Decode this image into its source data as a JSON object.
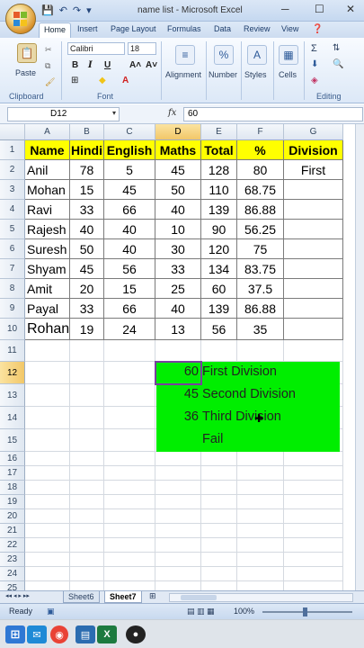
{
  "window": {
    "title": "name list - Microsoft Excel",
    "minimize": "─",
    "maximize": "☐",
    "close": "✕"
  },
  "qat": [
    "💾",
    "↶",
    "↷",
    "▾"
  ],
  "ribbon_tabs": [
    "Home",
    "Insert",
    "Page Layout",
    "Formulas",
    "Data",
    "Review",
    "View"
  ],
  "ribbon": {
    "paste": "Paste",
    "clipboard": "Clipboard",
    "font_name": "Calibri",
    "font_size": "18",
    "bold": "B",
    "italic": "I",
    "underline": "U",
    "grow_font": "A˄",
    "shrink_font": "A˅",
    "font_group": "Font",
    "alignment": "Alignment",
    "number": "Number",
    "styles": "Styles",
    "cells": "Cells",
    "editing": "Editing",
    "percent": "%",
    "sigma": "Σ"
  },
  "formula_bar": {
    "name_box": "D12",
    "fx": "fx",
    "value": "60"
  },
  "columns": [
    "A",
    "B",
    "C",
    "D",
    "E",
    "F",
    "G"
  ],
  "rows": [
    "1",
    "2",
    "3",
    "4",
    "5",
    "6",
    "7",
    "8",
    "9",
    "10",
    "11",
    "12",
    "13",
    "14",
    "15",
    "16",
    "17",
    "18",
    "19",
    "20",
    "21",
    "22",
    "23",
    "24",
    "25",
    "26"
  ],
  "table": {
    "headers": [
      "Name",
      "Hindi",
      "English",
      "Maths",
      "Total",
      "%",
      "Division"
    ],
    "data": [
      [
        "Anil",
        "78",
        "5",
        "45",
        "128",
        "80",
        "First"
      ],
      [
        "Mohan",
        "15",
        "45",
        "50",
        "110",
        "68.75",
        ""
      ],
      [
        "Ravi",
        "33",
        "66",
        "40",
        "139",
        "86.88",
        ""
      ],
      [
        "Rajesh",
        "40",
        "40",
        "10",
        "90",
        "56.25",
        ""
      ],
      [
        "Suresh",
        "50",
        "40",
        "30",
        "120",
        "75",
        ""
      ],
      [
        "Shyam",
        "45",
        "56",
        "33",
        "134",
        "83.75",
        ""
      ],
      [
        "Amit",
        "20",
        "15",
        "25",
        "60",
        "37.5",
        ""
      ],
      [
        "Payal",
        "33",
        "66",
        "40",
        "139",
        "86.88",
        ""
      ],
      [
        "Rohan",
        "19",
        "24",
        "13",
        "56",
        "35",
        ""
      ]
    ]
  },
  "criteria": [
    {
      "value": "60",
      "label": "First Division"
    },
    {
      "value": "45",
      "label": "Second Division"
    },
    {
      "value": "36",
      "label": "Third Division"
    },
    {
      "value": "",
      "label": "Fail"
    }
  ],
  "sheet_tabs": [
    "Sheet6",
    "Sheet7"
  ],
  "sheet_nav": "◂◂ ◂ ▸ ▸▸",
  "status": {
    "ready": "Ready",
    "zoom": "100%"
  },
  "colors": {
    "header_fill": "#ffff00",
    "criteria_fill": "#00ee00",
    "selection": "#7a3fa0"
  }
}
